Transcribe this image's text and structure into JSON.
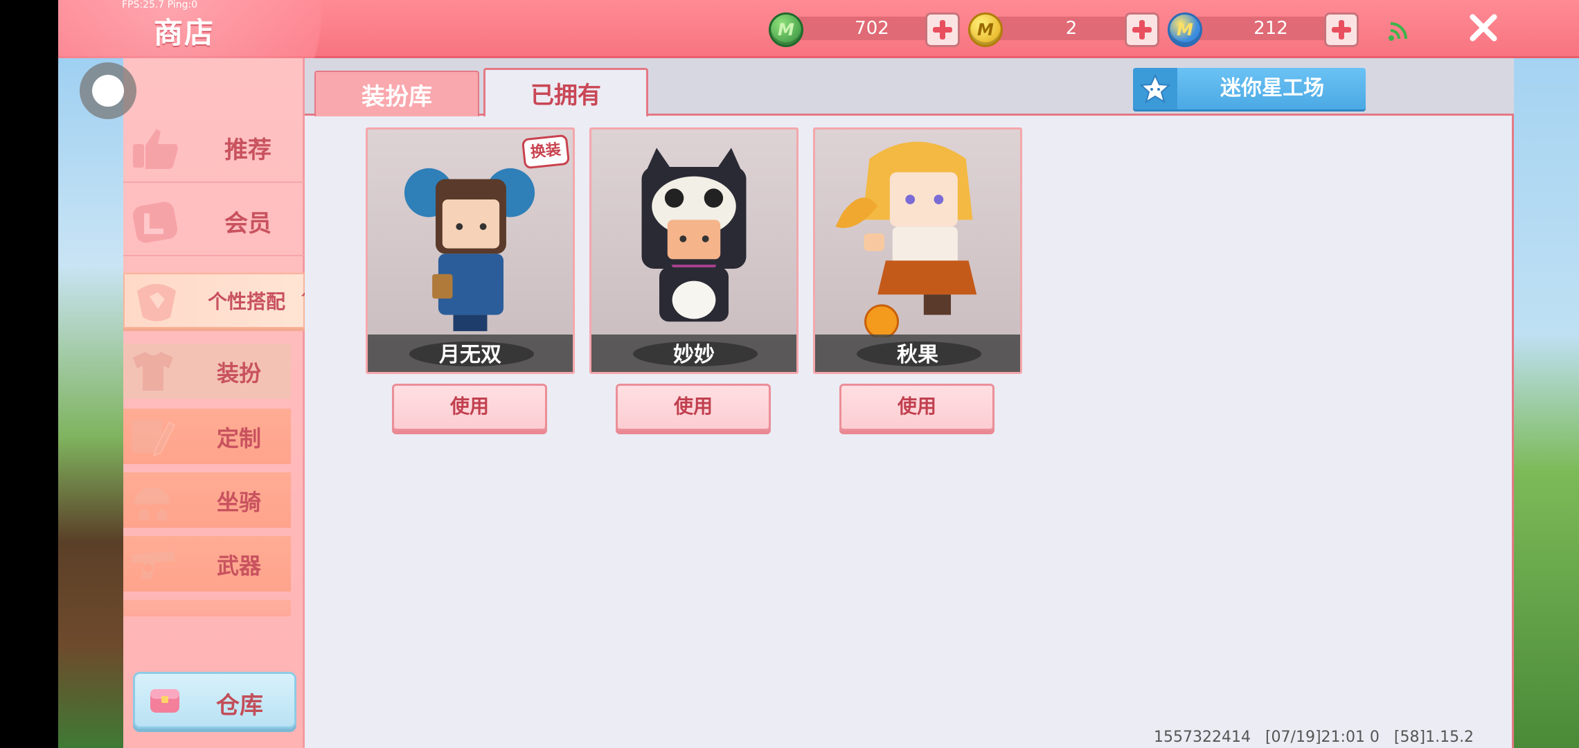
{
  "status": {
    "fps_ping": "FPS:25.7  Ping:0"
  },
  "header": {
    "title": "商店",
    "currencies": [
      {
        "icon": "green-m-coin-icon",
        "value": "702"
      },
      {
        "icon": "gold-m-coin-icon",
        "value": "2"
      },
      {
        "icon": "blue-m-coin-icon",
        "value": "212"
      }
    ]
  },
  "sidebar": {
    "items": [
      {
        "label": "推荐",
        "icon": "thumbs-up-icon"
      },
      {
        "label": "会员",
        "icon": "vip-icon"
      },
      {
        "label": "个性搭配",
        "icon": "personal-style-icon",
        "expanded": true
      }
    ],
    "sub_items": [
      {
        "label": "装扮",
        "icon": "shirt-icon",
        "selected": true
      },
      {
        "label": "定制",
        "icon": "pencil-icon"
      },
      {
        "label": "坐骑",
        "icon": "mount-icon"
      },
      {
        "label": "武器",
        "icon": "gun-icon"
      }
    ],
    "warehouse_label": "仓库"
  },
  "tabs": [
    {
      "label": "装扮库",
      "active": false
    },
    {
      "label": "已拥有",
      "active": true
    }
  ],
  "mini_workshop_label": "迷你星工场",
  "cards": [
    {
      "name": "月无双",
      "button": "使用",
      "badge": "换装"
    },
    {
      "name": "妙妙",
      "button": "使用"
    },
    {
      "name": "秋果",
      "button": "使用"
    }
  ],
  "footer": {
    "uid": "1557322414",
    "time": "[07/19]21:01 0",
    "version": "[58]1.15.2"
  },
  "colors": {
    "topbar": "#f77480",
    "accent_pink": "#e47984",
    "button_blue": "#4ba9e4"
  }
}
